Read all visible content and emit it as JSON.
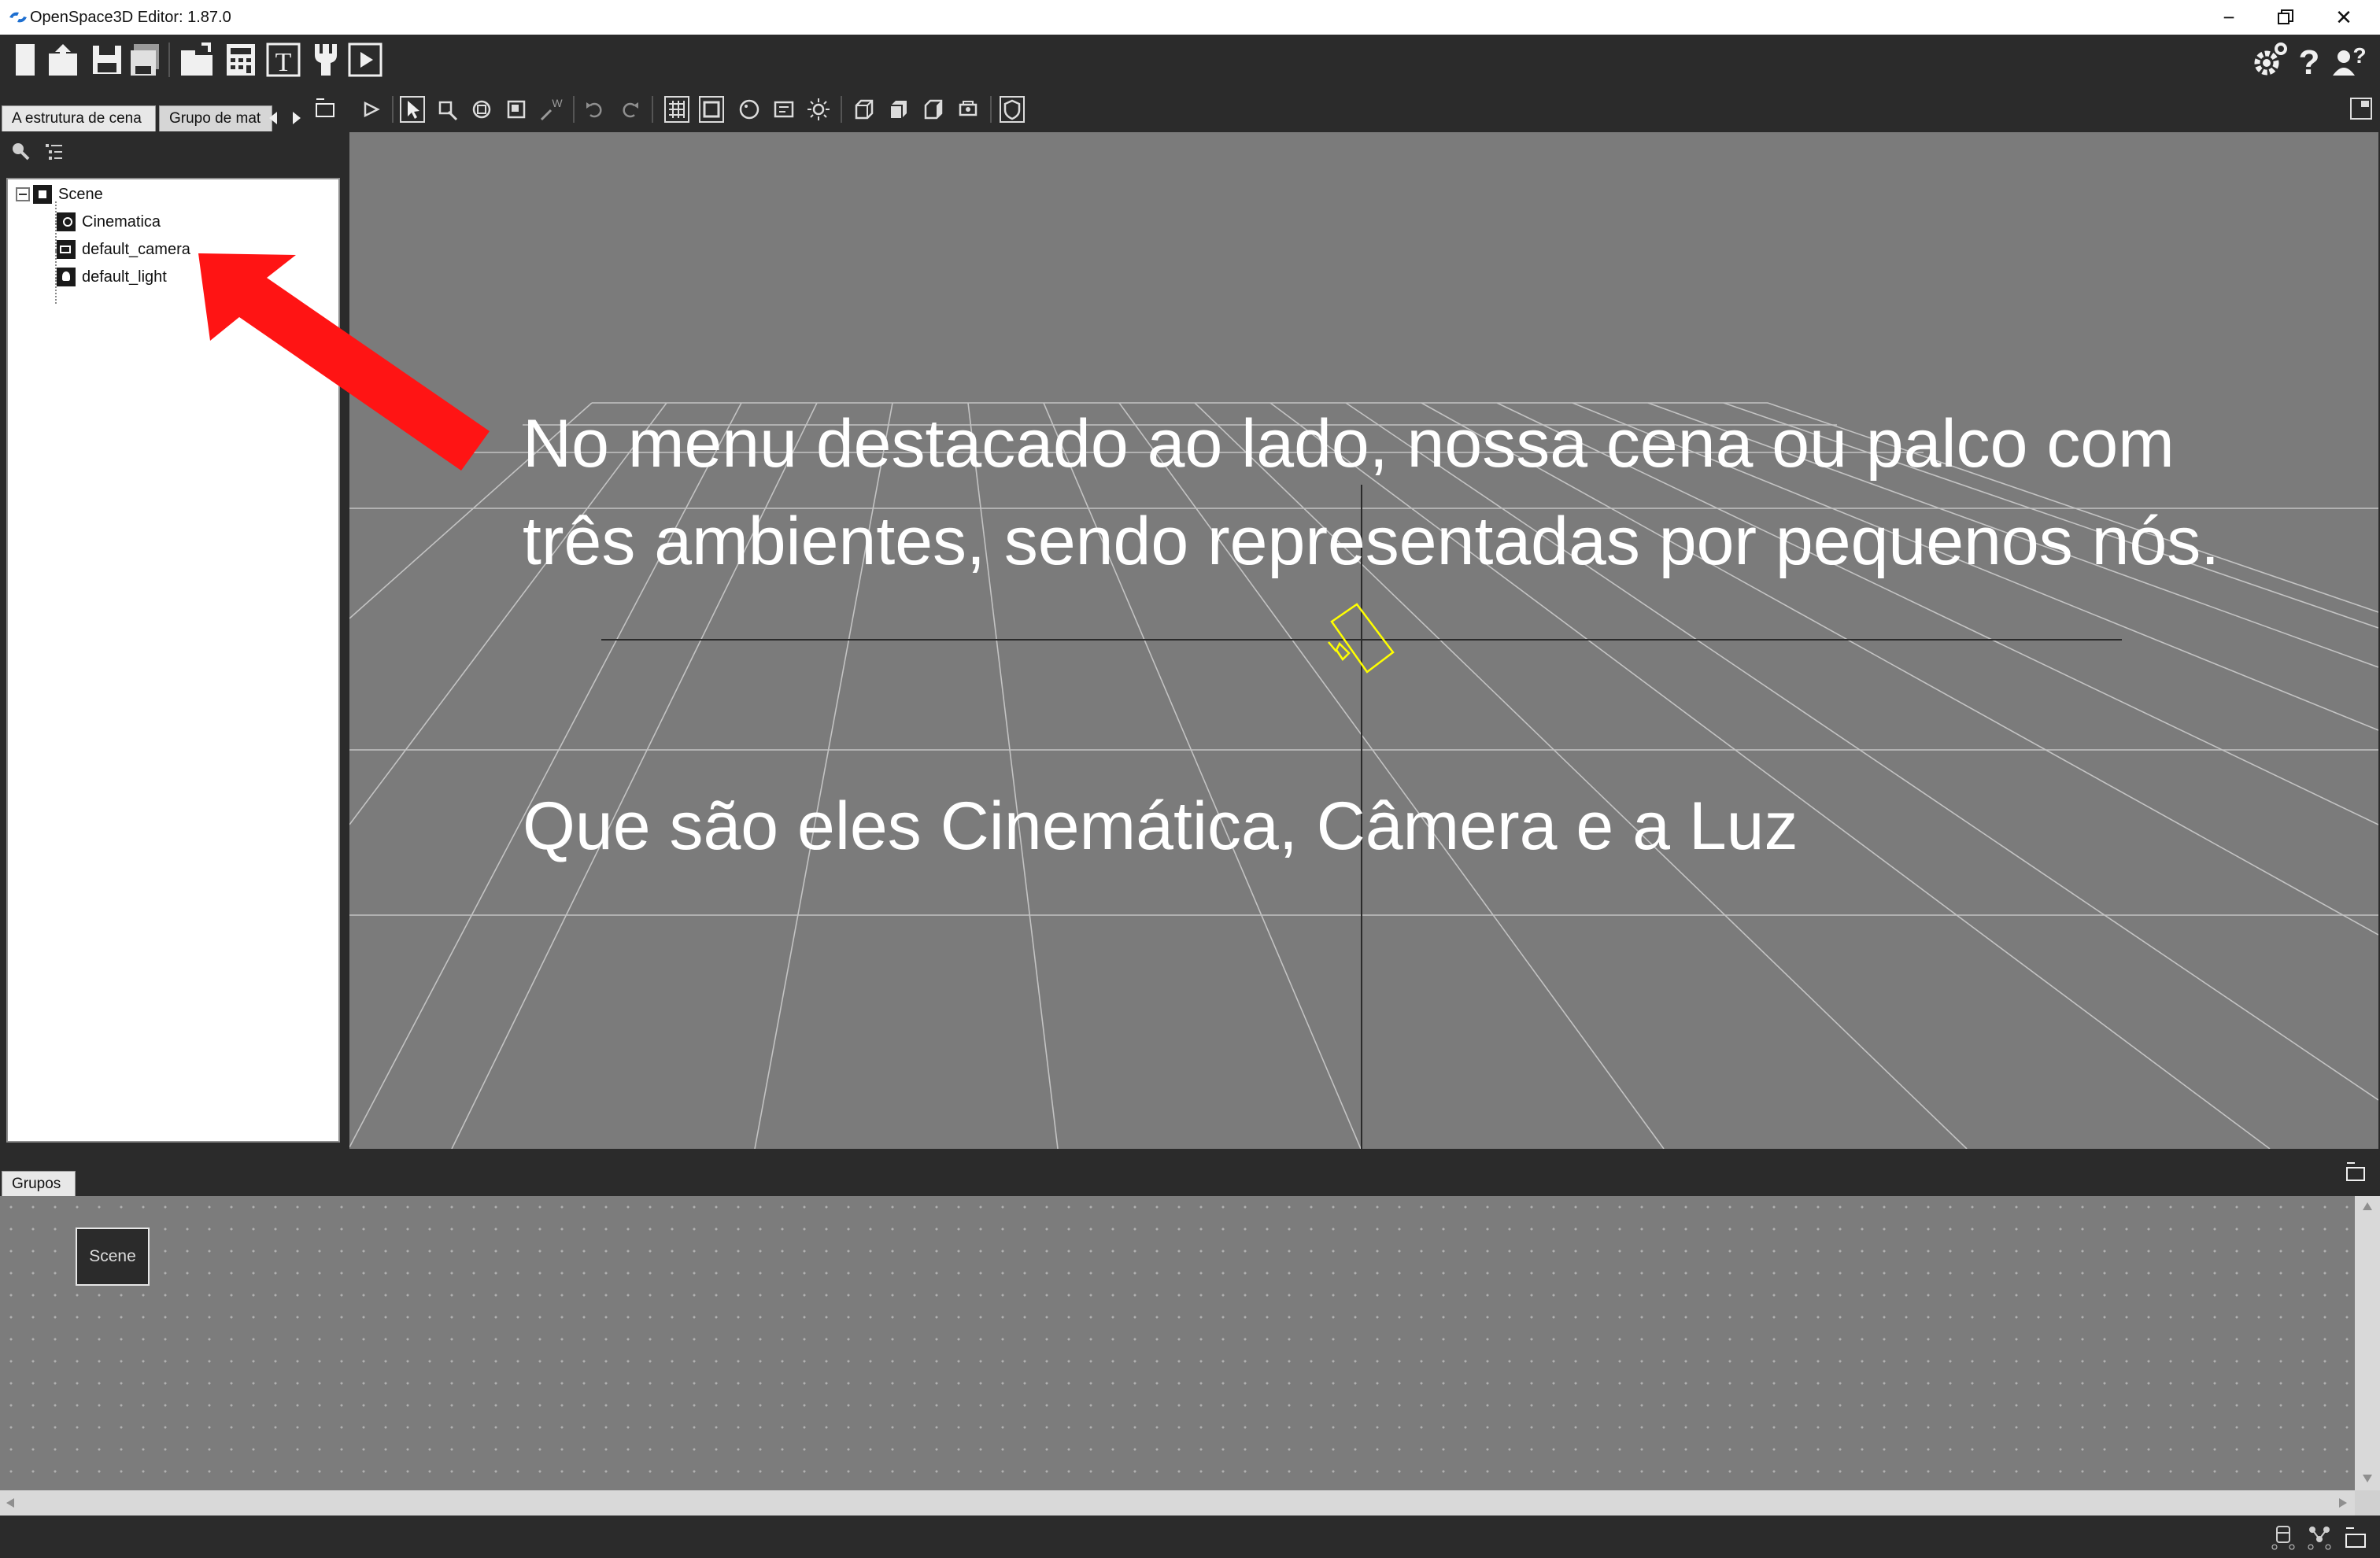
{
  "window": {
    "title": "OpenSpace3D Editor: 1.87.0",
    "controls": [
      "minimize",
      "restore",
      "close"
    ]
  },
  "toolbar": {
    "items": [
      "new-file-icon",
      "open-folder-icon",
      "save-icon",
      "save-as-icon",
      "import-icon",
      "calculator-icon",
      "text-resource-icon",
      "plugin-icon",
      "run-icon"
    ],
    "right_items": [
      "settings-icon",
      "help-icon",
      "user-help-icon"
    ]
  },
  "left_panel": {
    "tabs": [
      "A estrutura de cena",
      "Grupo de mat"
    ],
    "tree": {
      "root": "Scene",
      "children": [
        "Cinematica",
        "default_camera",
        "default_light"
      ]
    }
  },
  "viewport": {
    "tools": [
      "play-icon",
      "select-icon",
      "move-icon",
      "rotate-icon",
      "scale-icon",
      "world-scale-icon",
      "undo-icon",
      "redo-icon",
      "grid-icon",
      "view-box-icon",
      "sphere-icon",
      "texture-icon",
      "light-icon",
      "cube-icon",
      "cube-solid-icon",
      "cube-side-icon",
      "camera-icon",
      "shield-icon"
    ],
    "overlay_text_line1": "No menu destacado ao lado, nossa cena ou palco com",
    "overlay_text_line2": "três ambientes, sendo representadas por pequenos nós.",
    "overlay_text_line3": "Que são eles Cinemática, Câmera e a Luz"
  },
  "groups_panel": {
    "tab": "Grupos",
    "node_label": "Scene"
  },
  "colors": {
    "arrow": "#ff1414",
    "camera_gizmo": "#ffff00",
    "viewport_bg": "#7b7b7b"
  }
}
